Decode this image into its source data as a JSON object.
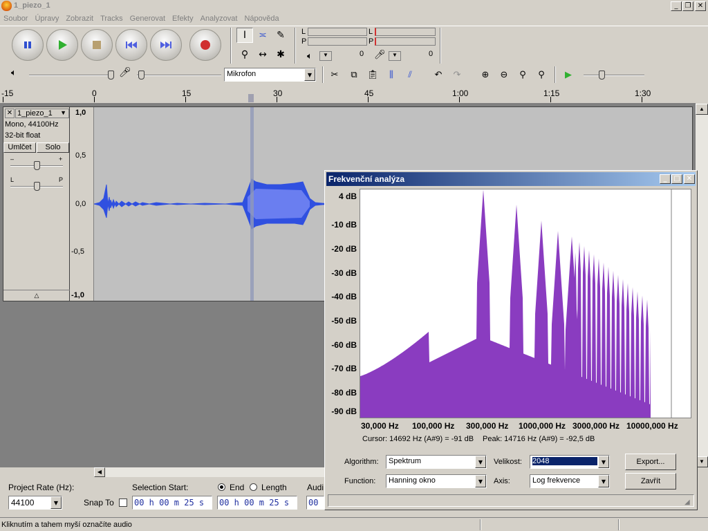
{
  "window": {
    "title": "1_piezo_1"
  },
  "menu": [
    "Soubor",
    "Úpravy",
    "Zobrazit",
    "Tracks",
    "Generovat",
    "Efekty",
    "Analyzovat",
    "Nápověda"
  ],
  "meters": {
    "left_label": "L",
    "right_label": "P",
    "out_zero": "0",
    "in_zero": "0"
  },
  "mixer": {
    "input_source": "Mikrofon"
  },
  "timeline": {
    "ticks": [
      "-15",
      "0",
      "15",
      "30",
      "45",
      "1:00",
      "1:15",
      "1:30"
    ]
  },
  "track": {
    "name": "1_piezo_1",
    "info_rate": "Mono, 44100Hz",
    "info_format": "32-bit float",
    "mute_label": "Umlčet",
    "solo_label": "Solo",
    "gain_minus": "–",
    "gain_plus": "+",
    "pan_left": "L",
    "pan_right": "P",
    "scale": [
      "1,0",
      "0,5",
      "0,0",
      "-0,5",
      "-1,0"
    ]
  },
  "selection_toolbar": {
    "project_rate_label": "Project Rate (Hz):",
    "project_rate_value": "44100",
    "snap_to_label": "Snap To",
    "selection_start_label": "Selection Start:",
    "end_label": "End",
    "length_label": "Length",
    "audio_pos_label": "Audi",
    "start_time": "00 h 00 m 25 s",
    "end_time": "00 h 00 m 25 s",
    "audio_pos": "00"
  },
  "status": {
    "text": "Kliknutím a tahem myší označíte audio"
  },
  "dialog": {
    "title": "Frekvenční analýza",
    "y_ticks": [
      "4 dB",
      "-10 dB",
      "-20 dB",
      "-30 dB",
      "-40 dB",
      "-50 dB",
      "-60 dB",
      "-70 dB",
      "-80 dB",
      "-90 dB"
    ],
    "x_ticks": [
      "30,000 Hz",
      "100,000 Hz",
      "300,000 Hz",
      "1000,000 Hz",
      "3000,000 Hz",
      "10000,000 Hz"
    ],
    "cursor_text": "Cursor: 14692 Hz (A#9) = -91 dB",
    "peak_text": "Peak: 14716 Hz (A#9) = -92,5 dB",
    "algorithm_label": "Algorithm:",
    "algorithm_value": "Spektrum",
    "size_label": "Velikost:",
    "size_value": "2048",
    "function_label": "Function:",
    "function_value": "Hanning okno",
    "axis_label": "Axis:",
    "axis_value": "Log frekvence",
    "export_label": "Export...",
    "close_label": "Zavřít",
    "spectrum_color": "#8a3cc0"
  }
}
